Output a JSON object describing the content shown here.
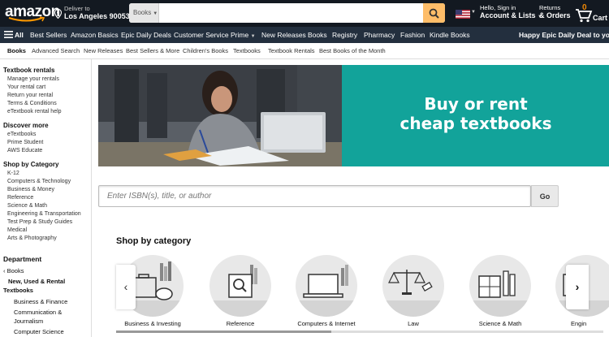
{
  "header": {
    "logo_text": "amazon",
    "deliver_line1": "Deliver to",
    "deliver_line2": "Los Angeles 90053",
    "search_category": "Books",
    "search_placeholder": "",
    "account_line1": "Hello, Sign in",
    "account_line2": "Account & Lists",
    "returns_line1": "Returns",
    "returns_line2": "& Orders",
    "cart_count": "0",
    "cart_label": "Cart",
    "colors": {
      "nav_bg": "#131921",
      "subnav_bg": "#232f3e",
      "search_button": "#febd69",
      "cart_count": "#f08804"
    }
  },
  "subnav": {
    "all_label": "All",
    "items": [
      "Best Sellers",
      "Amazon Basics",
      "Epic Daily Deals",
      "Customer Service",
      "Prime",
      "New Releases",
      "Books",
      "Registry",
      "Pharmacy",
      "Fashion",
      "Kindle Books"
    ],
    "promo": "Happy Epic Daily Deal to you"
  },
  "thirdnav": {
    "items": [
      "Books",
      "Advanced Search",
      "New Releases",
      "Best Sellers & More",
      "Children's Books",
      "Textbooks",
      "Textbook Rentals",
      "Best Books of the Month"
    ]
  },
  "sidebar": {
    "rentals_heading": "Textbook rentals",
    "rentals_links": [
      "Manage your rentals",
      "Your rental cart",
      "Return your rental",
      "Terms & Conditions",
      "eTextbook rental help"
    ],
    "discover_heading": "Discover more",
    "discover_links": [
      "eTextbooks",
      "Prime Student",
      "AWS Educate"
    ],
    "category_heading": "Shop by Category",
    "category_links": [
      "K-12",
      "Computers & Technology",
      "Business & Money",
      "Reference",
      "Science & Math",
      "Engineering & Transportation",
      "Test Prep & Study Guides",
      "Medical",
      "Arts & Photography"
    ],
    "department_heading": "Department",
    "department_back": "Books",
    "department_current": [
      "New, Used & Rental",
      "Textbooks"
    ],
    "department_children": [
      "Business & Finance",
      "Communication &",
      "Journalism",
      "Computer Science"
    ]
  },
  "hero": {
    "headline_line1": "Buy or rent",
    "headline_line2": "cheap textbooks",
    "accent_color": "#12a39a"
  },
  "isbn_search": {
    "placeholder": "Enter ISBN(s), title, or author",
    "go_label": "Go"
  },
  "categories": {
    "title": "Shop by category",
    "items": [
      {
        "label": "Business & Investing",
        "icon": "briefcase-piggybank-icon"
      },
      {
        "label": "Reference",
        "icon": "magnifier-box-icon"
      },
      {
        "label": "Computers & Internet",
        "icon": "laptop-icon"
      },
      {
        "label": "Law",
        "icon": "scales-gavel-icon"
      },
      {
        "label": "Science & Math",
        "icon": "flask-calculator-icon"
      },
      {
        "label": "Engin",
        "icon": "engineering-icon"
      }
    ],
    "scroll_position": 0
  }
}
